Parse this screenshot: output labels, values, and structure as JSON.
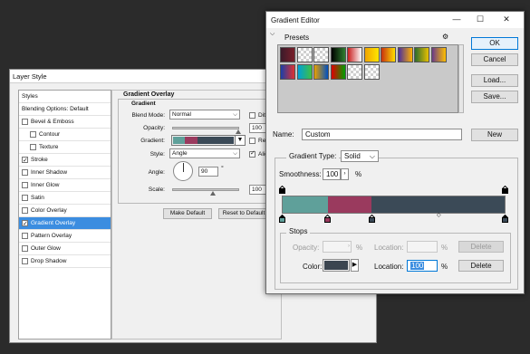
{
  "layer_style": {
    "title": "Layer Style",
    "styles_list": [
      {
        "label": "Styles",
        "checkbox": false,
        "checked": false,
        "indent": 0,
        "selected": false
      },
      {
        "label": "Blending Options: Default",
        "checkbox": false,
        "checked": false,
        "indent": 0,
        "selected": false
      },
      {
        "label": "Bevel & Emboss",
        "checkbox": true,
        "checked": false,
        "indent": 0,
        "selected": false
      },
      {
        "label": "Contour",
        "checkbox": true,
        "checked": false,
        "indent": 1,
        "selected": false
      },
      {
        "label": "Texture",
        "checkbox": true,
        "checked": false,
        "indent": 1,
        "selected": false
      },
      {
        "label": "Stroke",
        "checkbox": true,
        "checked": true,
        "indent": 0,
        "selected": false
      },
      {
        "label": "Inner Shadow",
        "checkbox": true,
        "checked": false,
        "indent": 0,
        "selected": false
      },
      {
        "label": "Inner Glow",
        "checkbox": true,
        "checked": false,
        "indent": 0,
        "selected": false
      },
      {
        "label": "Satin",
        "checkbox": true,
        "checked": false,
        "indent": 0,
        "selected": false
      },
      {
        "label": "Color Overlay",
        "checkbox": true,
        "checked": false,
        "indent": 0,
        "selected": false
      },
      {
        "label": "Gradient Overlay",
        "checkbox": true,
        "checked": true,
        "indent": 0,
        "selected": true
      },
      {
        "label": "Pattern Overlay",
        "checkbox": true,
        "checked": false,
        "indent": 0,
        "selected": false
      },
      {
        "label": "Outer Glow",
        "checkbox": true,
        "checked": false,
        "indent": 0,
        "selected": false
      },
      {
        "label": "Drop Shadow",
        "checkbox": true,
        "checked": false,
        "indent": 0,
        "selected": false
      }
    ],
    "section_title": "Gradient Overlay",
    "group_title": "Gradient",
    "blend_mode_label": "Blend Mode:",
    "blend_mode_value": "Normal",
    "dither_label": "Dither",
    "opacity_label": "Opacity:",
    "opacity_value": "100",
    "gradient_label": "Gradient:",
    "reverse_label": "Reverse",
    "style_label": "Style:",
    "style_value": "Angle",
    "align_label": "Align w",
    "angle_label": "Angle:",
    "angle_value": "90",
    "angle_unit": "°",
    "scale_label": "Scale:",
    "scale_value": "100",
    "make_default_label": "Make Default",
    "reset_default_label": "Reset to Default"
  },
  "gradient_editor": {
    "title": "Gradient Editor",
    "presets_label": "Presets",
    "gear_icon": "gear-icon",
    "preset_swatches": [
      [
        "#3a1a2a",
        "#7a1f2a"
      ],
      [
        "#d0d0d0",
        "#ffffff"
      ],
      [
        "#dcdcdc",
        "#ffffff"
      ],
      [
        "#000000",
        "#2f7f2f"
      ],
      [
        "#c91d1d",
        "#ffffff"
      ],
      [
        "#f0a400",
        "#ffe600"
      ],
      [
        "#c83010",
        "#ffe000"
      ],
      [
        "#4a2ea0",
        "#ffb000"
      ],
      [
        "#2c6b2f",
        "#e8c000"
      ],
      [
        "#6a3a8a",
        "#ffc000"
      ],
      [
        "#1a3fa8",
        "#e03030"
      ],
      [
        "#00a0d8",
        "#40c040"
      ],
      [
        "#e8a000",
        "#0050c0"
      ],
      [
        "#e00000",
        "#00a000"
      ],
      [
        "#dcdcdc",
        "#ffffff"
      ],
      [
        "#dcdcdc",
        "#ffffff"
      ]
    ],
    "buttons": {
      "ok": "OK",
      "cancel": "Cancel",
      "load": "Load...",
      "save": "Save...",
      "new": "New"
    },
    "name_label": "Name:",
    "name_value": "Custom",
    "gradient_type_label": "Gradient Type:",
    "gradient_type_value": "Solid",
    "smoothness_label": "Smoothness:",
    "smoothness_value": "100",
    "smoothness_unit": "%",
    "gradient_colors": [
      "#5fa09a",
      "#9a3a5e",
      "#3b4a57"
    ],
    "stops_label": "Stops",
    "opacity_label": "Opacity:",
    "opacity_unit": "%",
    "location_label": "Location:",
    "location_unit": "%",
    "delete_label": "Delete",
    "color_label": "Color:",
    "color_value": "#3b4550",
    "location_value": "100"
  }
}
